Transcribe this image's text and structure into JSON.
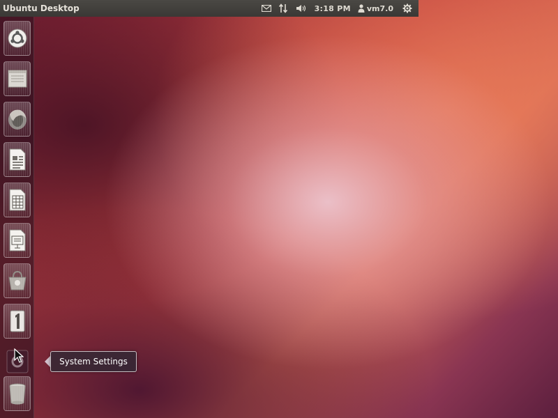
{
  "top_panel": {
    "title": "Ubuntu Desktop",
    "indicators": {
      "mail_icon": "envelope-icon",
      "network_icon": "network-arrows-icon",
      "sound_icon": "speaker-icon",
      "clock": "3:18 PM",
      "user": "vm7.0",
      "session_icon": "gear-icon"
    }
  },
  "launcher": {
    "items": [
      {
        "name": "dash-home",
        "icon": "ubuntu-logo-icon"
      },
      {
        "name": "home-folder",
        "icon": "file-manager-icon"
      },
      {
        "name": "firefox",
        "icon": "firefox-icon"
      },
      {
        "name": "libreoffice-writer",
        "icon": "writer-document-icon"
      },
      {
        "name": "libreoffice-calc",
        "icon": "calc-spreadsheet-icon"
      },
      {
        "name": "libreoffice-impress",
        "icon": "impress-presentation-icon"
      },
      {
        "name": "ubuntu-software-center",
        "icon": "software-center-icon"
      },
      {
        "name": "workspace-switcher",
        "icon": "workspace-switcher-icon"
      },
      {
        "name": "system-settings",
        "icon": "settings-icon"
      },
      {
        "name": "trash",
        "icon": "trash-icon"
      }
    ]
  },
  "tooltip": {
    "label": "System Settings"
  },
  "colors": {
    "panel": "#3c3b37",
    "tooltip_bg": "#322834",
    "wallpaper_accent": "#dd4814"
  }
}
